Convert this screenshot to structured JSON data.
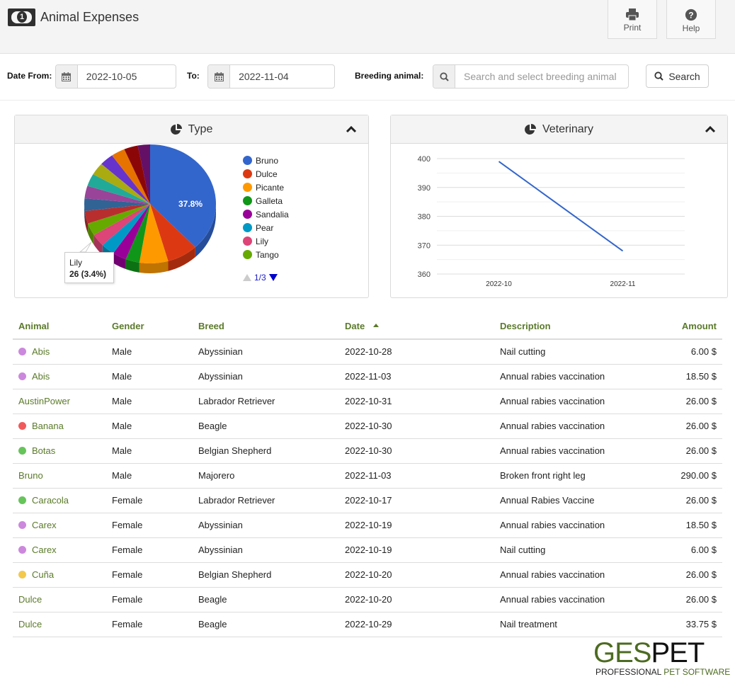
{
  "header": {
    "icon": "money-bill-icon",
    "title": "Animal Expenses",
    "print_label": "Print",
    "help_label": "Help"
  },
  "filters": {
    "date_from_label": "Date From:",
    "date_from_value": "2022-10-05",
    "date_to_label": "To:",
    "date_to_value": "2022-11-04",
    "breeding_label": "Breeding animal:",
    "breeding_placeholder": "Search and select breeding animal",
    "search_label": "Search"
  },
  "panels": {
    "type_title": "Type",
    "vet_title": "Veterinary"
  },
  "chart_data": [
    {
      "type": "pie",
      "title": "Type",
      "style": "3d",
      "legend_position": "right",
      "legend_page": "1/3",
      "legend_visible": [
        "Bruno",
        "Dulce",
        "Picante",
        "Galleta",
        "Sandalia",
        "Pear",
        "Lily",
        "Tango"
      ],
      "slices": [
        {
          "label": "Bruno",
          "percent": 37.8,
          "color": "#3366cc"
        },
        {
          "label": "Dulce",
          "percent": 7.6,
          "color": "#dc3912"
        },
        {
          "label": "Picante",
          "percent": 7.0,
          "color": "#ff9900"
        },
        {
          "label": "Galleta",
          "percent": 3.4,
          "color": "#109618"
        },
        {
          "label": "Sandalia",
          "percent": 3.4,
          "color": "#990099"
        },
        {
          "label": "Pear",
          "percent": 3.4,
          "color": "#0099c6"
        },
        {
          "label": "Lily",
          "percent": 3.4,
          "value": 26,
          "color": "#dd4477"
        },
        {
          "label": "Tango",
          "percent": 3.4,
          "color": "#66aa00"
        },
        {
          "label": "",
          "percent": 3.4,
          "color": "#b82e2e"
        },
        {
          "label": "",
          "percent": 3.4,
          "color": "#316395"
        },
        {
          "label": "",
          "percent": 3.4,
          "color": "#994499"
        },
        {
          "label": "",
          "percent": 3.4,
          "color": "#22aa99"
        },
        {
          "label": "",
          "percent": 3.4,
          "color": "#aaaa11"
        },
        {
          "label": "",
          "percent": 3.4,
          "color": "#6633cc"
        },
        {
          "label": "",
          "percent": 3.4,
          "color": "#e67300"
        },
        {
          "label": "",
          "percent": 3.4,
          "color": "#8b0707"
        },
        {
          "label": "",
          "percent": 3.0,
          "color": "#651067"
        }
      ],
      "data_label": "37.8%",
      "tooltip": {
        "label": "Lily",
        "value_text": "26 (3.4%)"
      }
    },
    {
      "type": "line",
      "title": "Veterinary",
      "x": [
        "2022-10",
        "2022-11"
      ],
      "series": [
        {
          "name": "Veterinary",
          "values": [
            399,
            368
          ],
          "color": "#3366cc"
        }
      ],
      "ylim": [
        360,
        400
      ],
      "yticks": [
        360,
        370,
        380,
        390,
        400
      ],
      "grid": true
    }
  ],
  "table": {
    "columns": [
      "Animal",
      "Gender",
      "Breed",
      "Date",
      "Description",
      "Amount"
    ],
    "sorted_column": "Date",
    "rows": [
      {
        "animal": "Abis",
        "dot": "#cc88dd",
        "gender": "Male",
        "breed": "Abyssinian",
        "date": "2022-10-28",
        "description": "Nail cutting",
        "amount": "6.00 $"
      },
      {
        "animal": "Abis",
        "dot": "#cc88dd",
        "gender": "Male",
        "breed": "Abyssinian",
        "date": "2022-11-03",
        "description": "Annual rabies vaccination",
        "amount": "18.50 $"
      },
      {
        "animal": "AustinPower",
        "dot": "",
        "gender": "Male",
        "breed": "Labrador Retriever",
        "date": "2022-10-31",
        "description": "Annual rabies vaccination",
        "amount": "26.00 $"
      },
      {
        "animal": "Banana",
        "dot": "#f05a5a",
        "gender": "Male",
        "breed": "Beagle",
        "date": "2022-10-30",
        "description": "Annual rabies vaccination",
        "amount": "26.00 $"
      },
      {
        "animal": "Botas",
        "dot": "#66c45a",
        "gender": "Male",
        "breed": "Belgian Shepherd",
        "date": "2022-10-30",
        "description": "Annual rabies vaccination",
        "amount": "26.00 $"
      },
      {
        "animal": "Bruno",
        "dot": "",
        "gender": "Male",
        "breed": "Majorero",
        "date": "2022-11-03",
        "description": "Broken front right leg",
        "amount": "290.00 $"
      },
      {
        "animal": "Caracola",
        "dot": "#66c45a",
        "gender": "Female",
        "breed": "Labrador Retriever",
        "date": "2022-10-17",
        "description": "Annual Rabies Vaccine",
        "amount": "26.00 $"
      },
      {
        "animal": "Carex",
        "dot": "#cc88dd",
        "gender": "Female",
        "breed": "Abyssinian",
        "date": "2022-10-19",
        "description": "Annual rabies vaccination",
        "amount": "18.50 $"
      },
      {
        "animal": "Carex",
        "dot": "#cc88dd",
        "gender": "Female",
        "breed": "Abyssinian",
        "date": "2022-10-19",
        "description": "Nail cutting",
        "amount": "6.00 $"
      },
      {
        "animal": "Cuña",
        "dot": "#f2c94c",
        "gender": "Female",
        "breed": "Belgian Shepherd",
        "date": "2022-10-20",
        "description": "Annual rabies vaccination",
        "amount": "26.00 $"
      },
      {
        "animal": "Dulce",
        "dot": "",
        "gender": "Female",
        "breed": "Beagle",
        "date": "2022-10-20",
        "description": "Annual rabies vaccination",
        "amount": "26.00 $"
      },
      {
        "animal": "Dulce",
        "dot": "",
        "gender": "Female",
        "breed": "Beagle",
        "date": "2022-10-29",
        "description": "Nail treatment",
        "amount": "33.75 $"
      }
    ]
  },
  "footer_logo": {
    "part1": "GES",
    "part2": "PET",
    "tagline1": "PROFESSIONAL ",
    "tagline2": "PET SOFTWARE"
  }
}
